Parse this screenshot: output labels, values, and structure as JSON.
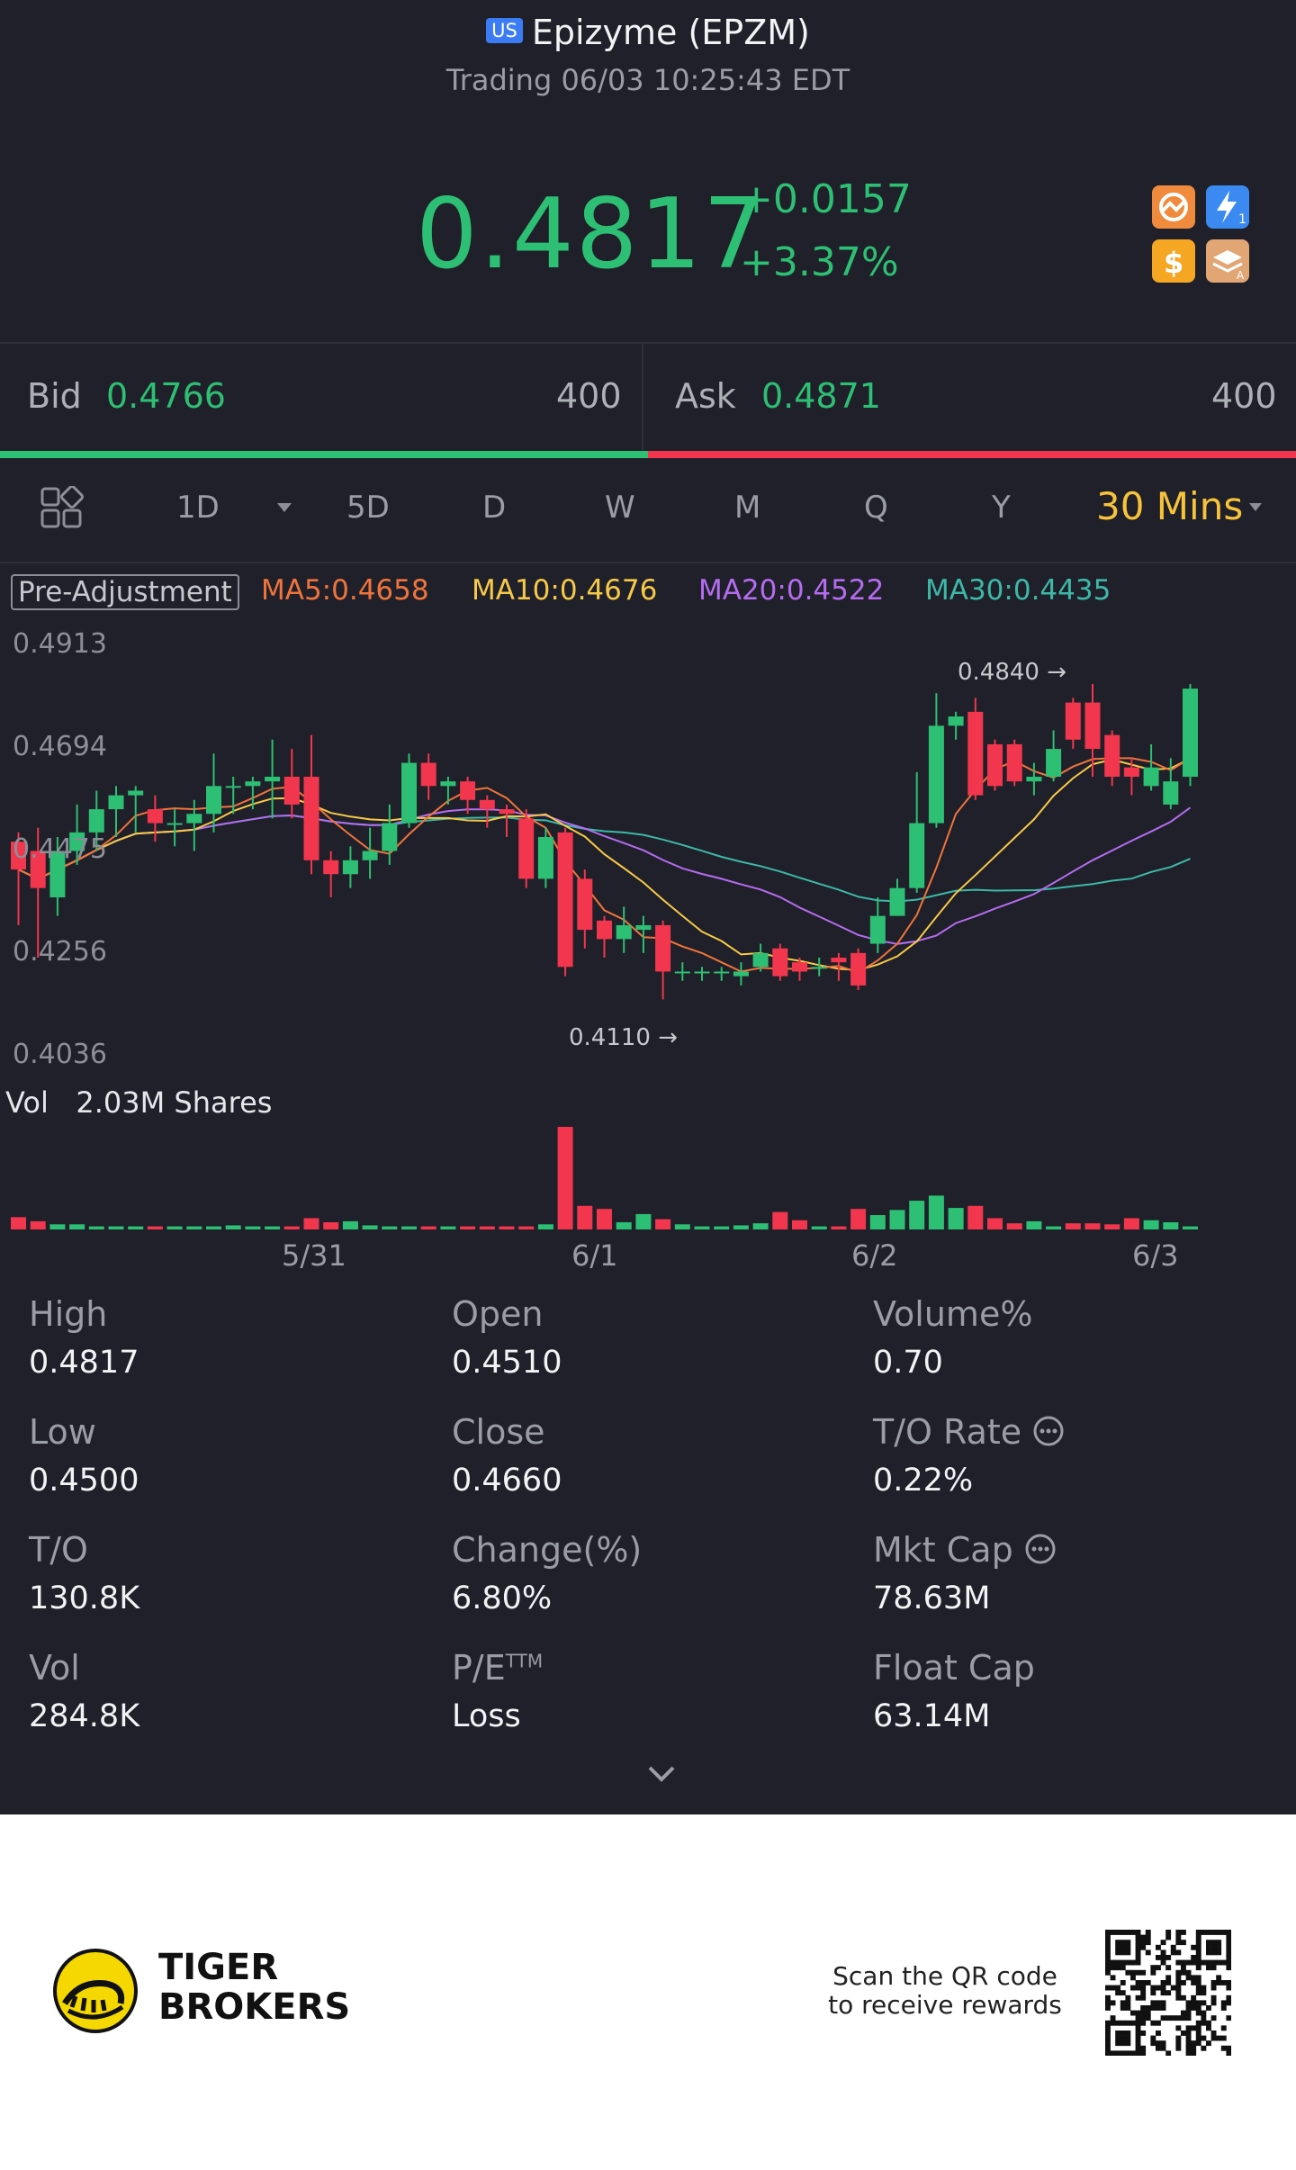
{
  "header": {
    "market_badge": "US",
    "title": "Epizyme (EPZM)",
    "status": "Trading 06/03 10:25:43 EDT"
  },
  "quote": {
    "price": "0.4817",
    "change": "+0.0157",
    "change_pct": "+3.37%",
    "up_color": "#2dbf73",
    "down_color": "#f2364d"
  },
  "app_icons": [
    "chart-app-icon",
    "lightning-app-icon",
    "dollar-app-icon",
    "layers-app-icon"
  ],
  "bid_ask": {
    "bid_label": "Bid",
    "bid_price": "0.4766",
    "bid_qty": "400",
    "ask_label": "Ask",
    "ask_price": "0.4871",
    "ask_qty": "400",
    "bid_ratio": 0.5
  },
  "tabs": [
    "1D",
    "5D",
    "D",
    "W",
    "M",
    "Q",
    "Y"
  ],
  "active_tab": "30 Mins",
  "indicators": {
    "pre_adjustment": "Pre-Adjustment",
    "ma5": "MA5:0.4658",
    "ma10": "MA10:0.4676",
    "ma20": "MA20:0.4522",
    "ma30": "MA30:0.4435"
  },
  "chart_data": {
    "type": "candlestick",
    "y_ticks": [
      "0.4913",
      "0.4694",
      "0.4475",
      "0.4256",
      "0.4036"
    ],
    "ylim": [
      0.4036,
      0.4913
    ],
    "high_marker": "0.4840",
    "low_marker": "0.4110",
    "x_ticks": [
      "5/31",
      "6/1",
      "6/2",
      "6/3"
    ],
    "volume_label": "Vol",
    "volume_total": "2.03M Shares",
    "candles": [
      [
        0.448,
        0.442,
        0.45,
        0.43
      ],
      [
        0.446,
        0.438,
        0.451,
        0.423
      ],
      [
        0.436,
        0.446,
        0.449,
        0.432
      ],
      [
        0.446,
        0.45,
        0.456,
        0.443
      ],
      [
        0.45,
        0.455,
        0.459,
        0.446
      ],
      [
        0.455,
        0.458,
        0.46,
        0.449
      ],
      [
        0.458,
        0.459,
        0.46,
        0.45
      ],
      [
        0.455,
        0.452,
        0.458,
        0.448
      ],
      [
        0.452,
        0.452,
        0.455,
        0.447
      ],
      [
        0.452,
        0.454,
        0.457,
        0.446
      ],
      [
        0.454,
        0.46,
        0.467,
        0.45
      ],
      [
        0.46,
        0.46,
        0.462,
        0.454
      ],
      [
        0.46,
        0.461,
        0.462,
        0.455
      ],
      [
        0.461,
        0.462,
        0.47,
        0.453
      ],
      [
        0.462,
        0.456,
        0.468,
        0.453
      ],
      [
        0.462,
        0.444,
        0.471,
        0.441
      ],
      [
        0.444,
        0.441,
        0.446,
        0.436
      ],
      [
        0.441,
        0.444,
        0.447,
        0.438
      ],
      [
        0.444,
        0.446,
        0.451,
        0.44
      ],
      [
        0.446,
        0.452,
        0.456,
        0.443
      ],
      [
        0.452,
        0.465,
        0.467,
        0.451
      ],
      [
        0.465,
        0.46,
        0.467,
        0.457
      ],
      [
        0.46,
        0.461,
        0.462,
        0.456
      ],
      [
        0.461,
        0.457,
        0.462,
        0.454
      ],
      [
        0.457,
        0.455,
        0.458,
        0.451
      ],
      [
        0.455,
        0.454,
        0.456,
        0.449
      ],
      [
        0.453,
        0.44,
        0.455,
        0.438
      ],
      [
        0.44,
        0.449,
        0.451,
        0.438
      ],
      [
        0.45,
        0.421,
        0.451,
        0.419
      ],
      [
        0.44,
        0.429,
        0.442,
        0.425
      ],
      [
        0.431,
        0.427,
        0.432,
        0.423
      ],
      [
        0.427,
        0.43,
        0.434,
        0.424
      ],
      [
        0.429,
        0.43,
        0.432,
        0.424
      ],
      [
        0.43,
        0.42,
        0.431,
        0.414
      ],
      [
        0.42,
        0.42,
        0.422,
        0.418
      ],
      [
        0.42,
        0.42,
        0.421,
        0.418
      ],
      [
        0.42,
        0.42,
        0.421,
        0.418
      ],
      [
        0.419,
        0.42,
        0.422,
        0.417
      ],
      [
        0.421,
        0.424,
        0.426,
        0.42
      ],
      [
        0.425,
        0.419,
        0.426,
        0.418
      ],
      [
        0.422,
        0.42,
        0.423,
        0.418
      ],
      [
        0.421,
        0.421,
        0.423,
        0.419
      ],
      [
        0.423,
        0.422,
        0.424,
        0.418
      ],
      [
        0.424,
        0.417,
        0.425,
        0.416
      ],
      [
        0.426,
        0.432,
        0.436,
        0.424
      ],
      [
        0.432,
        0.438,
        0.44,
        0.432
      ],
      [
        0.438,
        0.452,
        0.463,
        0.437
      ],
      [
        0.452,
        0.473,
        0.48,
        0.451
      ],
      [
        0.473,
        0.475,
        0.476,
        0.47
      ],
      [
        0.476,
        0.458,
        0.479,
        0.457
      ],
      [
        0.469,
        0.46,
        0.47,
        0.459
      ],
      [
        0.469,
        0.461,
        0.47,
        0.46
      ],
      [
        0.461,
        0.462,
        0.465,
        0.458
      ],
      [
        0.462,
        0.468,
        0.472,
        0.461
      ],
      [
        0.478,
        0.47,
        0.479,
        0.468
      ],
      [
        0.478,
        0.468,
        0.482,
        0.462
      ],
      [
        0.471,
        0.462,
        0.472,
        0.46
      ],
      [
        0.464,
        0.462,
        0.466,
        0.458
      ],
      [
        0.46,
        0.464,
        0.469,
        0.459
      ],
      [
        0.456,
        0.461,
        0.466,
        0.455
      ],
      [
        0.462,
        0.481,
        0.482,
        0.46
      ]
    ],
    "volumes": [
      0.12,
      0.08,
      0.05,
      0.05,
      0.03,
      0.03,
      0.03,
      0.03,
      0.03,
      0.03,
      0.03,
      0.04,
      0.03,
      0.03,
      0.03,
      0.11,
      0.07,
      0.08,
      0.04,
      0.03,
      0.03,
      0.03,
      0.03,
      0.03,
      0.03,
      0.03,
      0.03,
      0.05,
      1.0,
      0.23,
      0.2,
      0.07,
      0.15,
      0.1,
      0.05,
      0.03,
      0.03,
      0.04,
      0.06,
      0.17,
      0.09,
      0.03,
      0.03,
      0.2,
      0.14,
      0.19,
      0.28,
      0.33,
      0.21,
      0.23,
      0.11,
      0.06,
      0.08,
      0.03,
      0.06,
      0.06,
      0.05,
      0.11,
      0.09,
      0.07,
      0.03
    ]
  },
  "stats": [
    {
      "label": "High",
      "value": "0.4817"
    },
    {
      "label": "Open",
      "value": "0.4510"
    },
    {
      "label": "Volume%",
      "value": "0.70"
    },
    {
      "label": "Low",
      "value": "0.4500"
    },
    {
      "label": "Close",
      "value": "0.4660"
    },
    {
      "label": "T/O Rate",
      "value": "0.22%"
    },
    {
      "label": "T/O",
      "value": "130.8K"
    },
    {
      "label": "Change(%)",
      "value": "6.80%"
    },
    {
      "label": "Mkt Cap",
      "value": "78.63M"
    },
    {
      "label": "Vol",
      "value": "284.8K"
    },
    {
      "label": "P/E",
      "value": "Loss"
    },
    {
      "label": "Float Cap",
      "value": "63.14M"
    }
  ],
  "pe_superscript": "TTM",
  "footer": {
    "brand_line1": "TIGER",
    "brand_line2": "BROKERS",
    "scan_line1": "Scan the QR code",
    "scan_line2": "to receive rewards"
  }
}
